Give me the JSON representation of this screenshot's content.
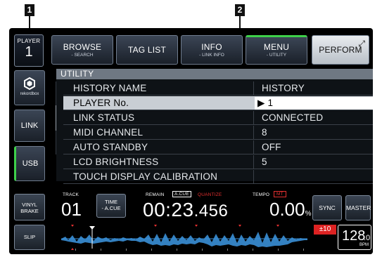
{
  "callouts": {
    "one": "1",
    "two": "2"
  },
  "player": {
    "label": "PLAYER",
    "number": "1"
  },
  "top_buttons": [
    {
      "main": "BROWSE",
      "sub": "- SEARCH"
    },
    {
      "main": "TAG LIST",
      "sub": ""
    },
    {
      "main": "INFO",
      "sub": "- LINK INFO"
    },
    {
      "main": "MENU",
      "sub": "- UTILITY"
    },
    {
      "main": "PERFORM",
      "sub": ""
    }
  ],
  "sidebar": {
    "rekordbox_label": "rekordbox",
    "link": "LINK",
    "usb": "USB"
  },
  "utility": {
    "header": "UTILITY",
    "rows": [
      {
        "name": "HISTORY NAME",
        "value": "HISTORY"
      },
      {
        "name": "PLAYER No.",
        "value": "▶ 1"
      },
      {
        "name": "LINK STATUS",
        "value": "CONNECTED"
      },
      {
        "name": "MIDI CHANNEL",
        "value": "8"
      },
      {
        "name": "AUTO STANDBY",
        "value": "OFF"
      },
      {
        "name": "LCD BRIGHTNESS",
        "value": "5"
      },
      {
        "name": "TOUCH DISPLAY CALIBRATION",
        "value": ""
      }
    ]
  },
  "deck": {
    "vinyl_brake": "VINYL BRAKE",
    "slip": "SLIP",
    "track_label": "TRACK",
    "track_number": "01",
    "time_label": "TIME",
    "time_mode": "- A.CUE",
    "remain_label": "REMAIN",
    "acue_label": "A.CUE",
    "quantize_label": "QUANTIZE",
    "time_value": "00:23",
    "time_ms": ".456",
    "tempo_label": "TEMPO",
    "mt_label": "MT",
    "tempo_value": "0.00",
    "tempo_unit": "%",
    "sync": "SYNC",
    "master": "MASTER",
    "tempo_range": "±10",
    "bpm_value": "128",
    "bpm_decimal": ".0",
    "bpm_unit": "BPM"
  },
  "colors": {
    "accent_green": "#3ed14a",
    "quantize_red": "#e53030",
    "waveform_blue": "#3a8fd6"
  }
}
